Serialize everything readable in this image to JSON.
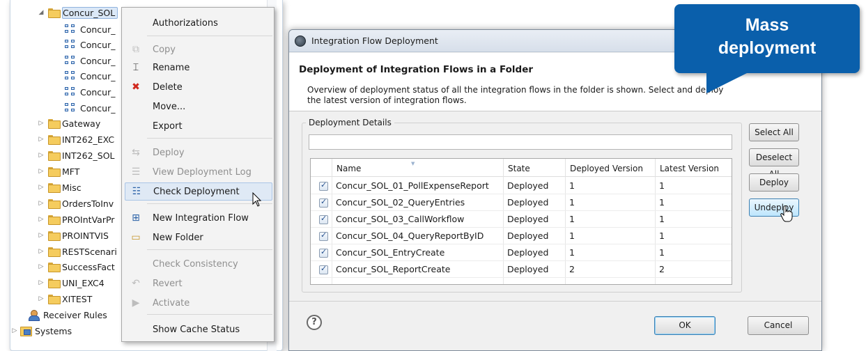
{
  "tree": {
    "items": [
      {
        "label": "Concur_SOL",
        "kind": "folder",
        "expanded": true,
        "selected": true
      },
      {
        "label": "Concur_",
        "kind": "flow"
      },
      {
        "label": "Concur_",
        "kind": "flow"
      },
      {
        "label": "Concur_",
        "kind": "flow"
      },
      {
        "label": "Concur_",
        "kind": "flow"
      },
      {
        "label": "Concur_",
        "kind": "flow"
      },
      {
        "label": "Concur_",
        "kind": "flow"
      },
      {
        "label": "Gateway",
        "kind": "folder"
      },
      {
        "label": "INT262_EXC",
        "kind": "folder"
      },
      {
        "label": "INT262_SOL",
        "kind": "folder"
      },
      {
        "label": "MFT",
        "kind": "folder"
      },
      {
        "label": "Misc",
        "kind": "folder"
      },
      {
        "label": "OrdersToInv",
        "kind": "folder"
      },
      {
        "label": "PROIntVarPr",
        "kind": "folder"
      },
      {
        "label": "PROINTVIS",
        "kind": "folder"
      },
      {
        "label": "RESTScenari",
        "kind": "folder"
      },
      {
        "label": "SuccessFact",
        "kind": "folder"
      },
      {
        "label": "UNI_EXC4",
        "kind": "folder"
      },
      {
        "label": "XITEST",
        "kind": "folder"
      },
      {
        "label": "Receiver Rules",
        "kind": "rules"
      },
      {
        "label": "Systems",
        "kind": "systems"
      }
    ],
    "expander_collapsed": "▷",
    "expander_expanded": "◢"
  },
  "context_menu": {
    "items": [
      {
        "label": "Authorizations",
        "icon": "",
        "enabled": true
      },
      {
        "label": "Copy",
        "icon": "copy-icon",
        "enabled": false
      },
      {
        "label": "Rename",
        "icon": "rename-icon",
        "enabled": true
      },
      {
        "label": "Delete",
        "icon": "delete-icon",
        "enabled": true
      },
      {
        "label": "Move...",
        "icon": "",
        "enabled": true
      },
      {
        "label": "Export",
        "icon": "",
        "enabled": true
      },
      {
        "label": "Deploy",
        "icon": "deploy-icon",
        "enabled": false
      },
      {
        "label": "View Deployment Log",
        "icon": "log-icon",
        "enabled": false
      },
      {
        "label": "Check Deployment",
        "icon": "check-deployment-icon",
        "enabled": true,
        "hovered": true
      },
      {
        "label": "New Integration Flow",
        "icon": "new-flow-icon",
        "enabled": true
      },
      {
        "label": "New Folder",
        "icon": "new-folder-icon",
        "enabled": true
      },
      {
        "label": "Check Consistency",
        "icon": "",
        "enabled": false
      },
      {
        "label": "Revert",
        "icon": "revert-icon",
        "enabled": false
      },
      {
        "label": "Activate",
        "icon": "activate-icon",
        "enabled": false
      },
      {
        "label": "Show Cache Status",
        "icon": "",
        "enabled": true
      }
    ]
  },
  "dialog": {
    "title": "Integration Flow Deployment",
    "heading": "Deployment of Integration Flows in a Folder",
    "description": "Overview of deployment status of all the integration flows in the folder is shown. Select and deploy the latest version of integration flows.",
    "group_label": "Deployment Details",
    "filter_value": "",
    "table": {
      "columns": [
        "Name",
        "State",
        "Deployed Version",
        "Latest Version"
      ],
      "rows": [
        {
          "checked": true,
          "name": "Concur_SOL_01_PollExpenseReport",
          "state": "Deployed",
          "deployed": "1",
          "latest": "1"
        },
        {
          "checked": true,
          "name": "Concur_SOL_02_QueryEntries",
          "state": "Deployed",
          "deployed": "1",
          "latest": "1"
        },
        {
          "checked": true,
          "name": "Concur_SOL_03_CallWorkflow",
          "state": "Deployed",
          "deployed": "1",
          "latest": "1"
        },
        {
          "checked": true,
          "name": "Concur_SOL_04_QueryReportByID",
          "state": "Deployed",
          "deployed": "1",
          "latest": "1"
        },
        {
          "checked": true,
          "name": "Concur_SOL_EntryCreate",
          "state": "Deployed",
          "deployed": "1",
          "latest": "1"
        },
        {
          "checked": true,
          "name": "Concur_SOL_ReportCreate",
          "state": "Deployed",
          "deployed": "2",
          "latest": "2"
        }
      ]
    },
    "buttons": {
      "select_all": "Select All",
      "deselect_all": "Deselect All",
      "deploy": "Deploy",
      "undeploy": "Undeploy",
      "ok": "OK",
      "cancel": "Cancel"
    },
    "help_symbol": "?"
  },
  "callout": {
    "text": "Mass deployment",
    "line1": "Mass",
    "line2": "deployment",
    "color": "#0a5fab"
  },
  "colors": {
    "selection": "#dbe8f7",
    "menu_hover": "#dfe9f5",
    "delete_red": "#d0281e"
  }
}
